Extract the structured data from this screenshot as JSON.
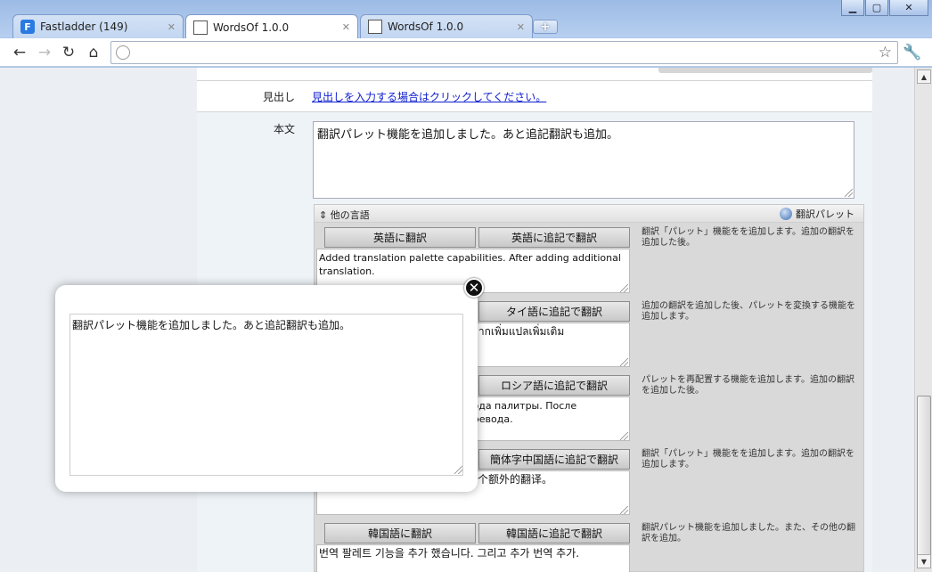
{
  "browser": {
    "tabs": [
      {
        "title": "Fastladder (149)",
        "active": false,
        "icon": "fastladder-icon"
      },
      {
        "title": "WordsOf 1.0.0",
        "active": true,
        "icon": "document-icon"
      },
      {
        "title": "WordsOf 1.0.0",
        "active": false,
        "icon": "document-icon"
      }
    ],
    "new_tab": "+",
    "address": ""
  },
  "form": {
    "heading_label": "見出し",
    "heading_link": "見出しを入力する場合はクリックしてください。",
    "body_label": "本文",
    "body_text": "翻訳パレット機能を追加しました。あと追記翻訳も追加。"
  },
  "other_languages": {
    "header": "⇕ 他の言語",
    "palette_label": "翻訳パレット",
    "blocks": [
      {
        "btn1": "英語に翻訳",
        "btn2": "英語に追記で翻訳",
        "text": "Added translation palette capabilities. After adding additional translation.",
        "desc": "翻訳「パレット」機能をを追加します。追加の翻訳を追加した後。"
      },
      {
        "btn1": "",
        "btn2": "タイ語に追記で翻訳",
        "text": "ังจากเพิ่มแปลเพิ่มเติม",
        "desc": "追加の翻訳を追加した後、パレットを変換する機能を追加します。"
      },
      {
        "btn1": "",
        "btn2": "ロシア語に追記で翻訳",
        "text": "вода палитры. После\nеревода.",
        "desc": "パレットを再配置する機能を追加します。追加の翻訳を追加した後。"
      },
      {
        "btn1": "",
        "btn2": "簡体字中国語に追記で翻訳",
        "text": "一个额外的翻译。",
        "desc": "翻訳「パレット」機能をを追加します。追加の翻訳を追加します。"
      },
      {
        "btn1": "韓国語に翻訳",
        "btn2": "韓国語に追記で翻訳",
        "text": "번역 팔레트 기능을 추가 했습니다. 그리고 추가 번역 추가.",
        "desc": "翻訳パレット機能を追加しました。また、その他の翻訳を追加。"
      }
    ]
  },
  "popup": {
    "text": "翻訳パレット機能を追加しました。あと追記翻訳も追加。",
    "close": "✕"
  }
}
